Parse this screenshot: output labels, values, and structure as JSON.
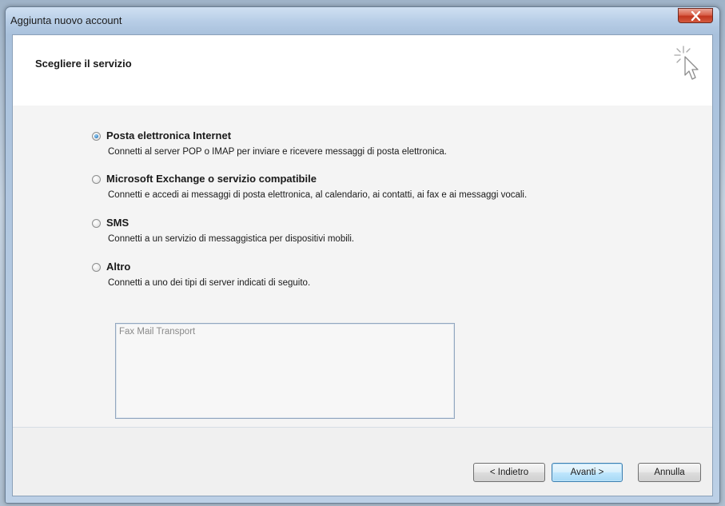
{
  "window": {
    "title": "Aggiunta nuovo account"
  },
  "header": {
    "title": "Scegliere il servizio",
    "icon": "cursor-sparkle-icon"
  },
  "options": [
    {
      "label": "Posta elettronica Internet",
      "description": "Connetti al server POP o IMAP per inviare e ricevere messaggi di posta elettronica.",
      "checked": true
    },
    {
      "label": "Microsoft Exchange o servizio compatibile",
      "description": "Connetti e accedi ai messaggi di posta elettronica, al calendario, ai contatti, ai fax e ai messaggi vocali.",
      "checked": false
    },
    {
      "label": "SMS",
      "description": "Connetti a un servizio di messaggistica per dispositivi mobili.",
      "checked": false
    },
    {
      "label": "Altro",
      "description": "Connetti a uno dei tipi di server indicati di seguito.",
      "checked": false
    }
  ],
  "server_list": {
    "items": [
      "Fax Mail Transport"
    ]
  },
  "buttons": {
    "back": "< Indietro",
    "next": "Avanti >",
    "cancel": "Annulla"
  },
  "colors": {
    "close_button": "#c2361f",
    "default_button_border": "#3c7fb1"
  }
}
